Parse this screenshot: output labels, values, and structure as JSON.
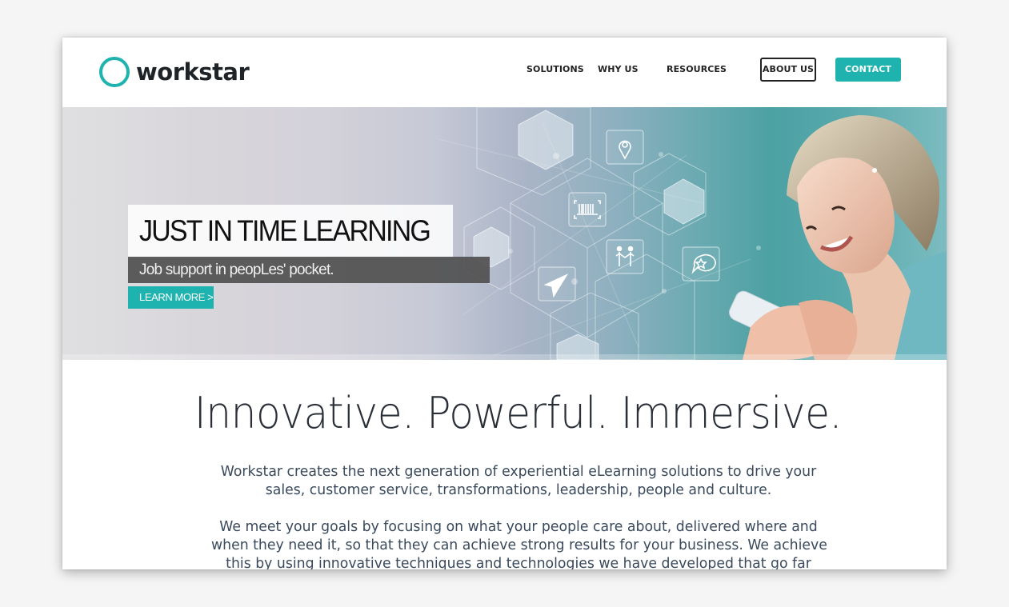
{
  "brand": {
    "name": "workstar",
    "accent_color": "#1fb3b0",
    "logo_icon": "swirl-ring-icon"
  },
  "nav": {
    "items": [
      {
        "label": "SOLUTIONS"
      },
      {
        "label": "WHY US"
      },
      {
        "label": "RESOURCES"
      },
      {
        "label": "ABOUT US"
      },
      {
        "label": "CONTACT"
      }
    ]
  },
  "hero": {
    "title": "JUST IN TIME LEARNING",
    "subtitle": "Job support in peopLes' pocket.",
    "cta_label": "LEARN MORE >",
    "icons": [
      "location-pin-icon",
      "barcode-scan-icon",
      "handshake-people-icon",
      "paper-plane-icon",
      "chat-star-icon"
    ]
  },
  "main": {
    "tagline": "Innovative. Powerful. Immersive.",
    "paragraphs": [
      {
        "lines": [
          "Workstar creates the next generation of experiential eLearning solutions to drive your",
          "sales, customer service, transformations, leadership, people and culture."
        ]
      },
      {
        "lines": [
          "We meet your goals by focusing on what your people care about, delivered where and",
          "when they need it, so that they can achieve strong results for your business. We achieve",
          "this by using innovative techniques and technologies we have developed that go far"
        ]
      }
    ]
  }
}
